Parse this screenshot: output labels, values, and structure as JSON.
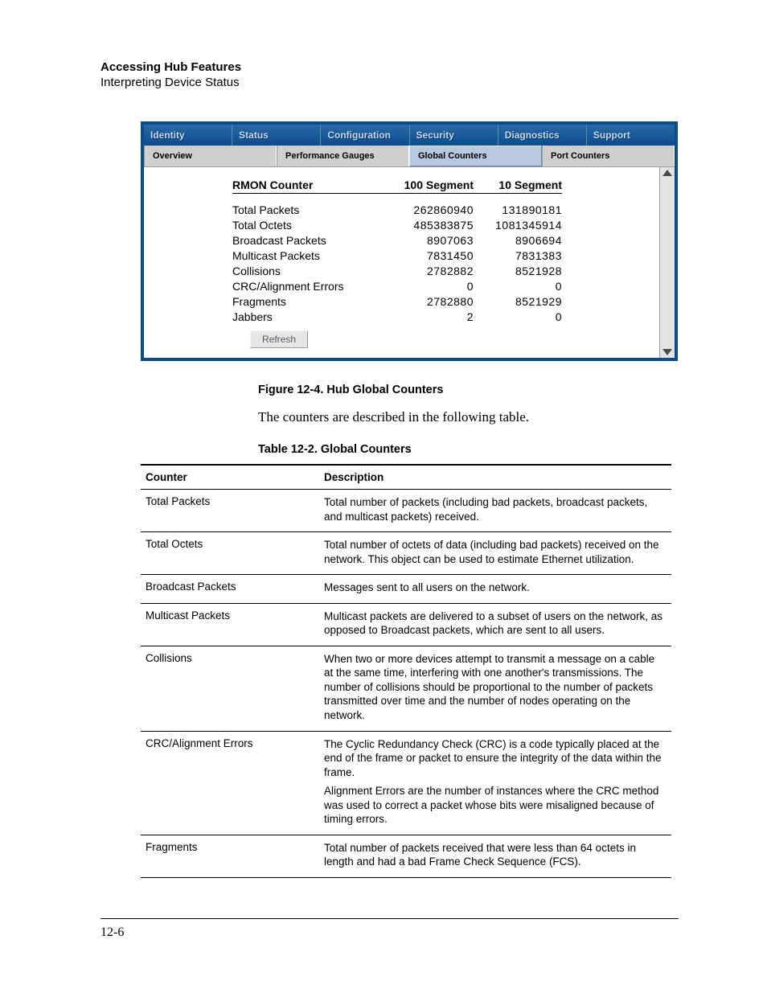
{
  "header": {
    "title": "Accessing Hub Features",
    "subtitle": "Interpreting Device Status"
  },
  "app": {
    "topTabs": [
      "Identity",
      "Status",
      "Configuration",
      "Security",
      "Diagnostics",
      "Support"
    ],
    "subTabs": [
      "Overview",
      "Performance Gauges",
      "Global Counters",
      "Port Counters"
    ],
    "subTabActiveIndex": 2,
    "dataHeader": {
      "name": "RMON Counter",
      "colA": "100 Segment",
      "colB": "10 Segment"
    },
    "rows": [
      {
        "name": "Total Packets",
        "a": "262860940",
        "b": "131890181"
      },
      {
        "name": "Total Octets",
        "a": "485383875",
        "b": "1081345914"
      },
      {
        "name": "Broadcast Packets",
        "a": "8907063",
        "b": "8906694"
      },
      {
        "name": "Multicast Packets",
        "a": "7831450",
        "b": "7831383"
      },
      {
        "name": "Collisions",
        "a": "2782882",
        "b": "8521928"
      },
      {
        "name": "CRC/Alignment Errors",
        "a": "0",
        "b": "0"
      },
      {
        "name": "Fragments",
        "a": "2782880",
        "b": "8521929"
      },
      {
        "name": "Jabbers",
        "a": "2",
        "b": "0"
      }
    ],
    "refreshLabel": "Refresh"
  },
  "figureCaption": "Figure 12-4. Hub Global Counters",
  "bodyParagraph": "The counters are described in the following table.",
  "tableCaption": "Table 12-2.   Global Counters",
  "descTable": {
    "headers": {
      "counter": "Counter",
      "description": "Description"
    },
    "rows": [
      {
        "counter": "Total Packets",
        "desc": [
          "Total number of packets (including bad packets, broadcast packets, and multicast packets) received."
        ]
      },
      {
        "counter": "Total Octets",
        "desc": [
          "Total number of octets of data (including bad packets) received on the network. This object can be used to estimate Ethernet utilization."
        ]
      },
      {
        "counter": "Broadcast Packets",
        "desc": [
          "Messages sent to all users on the network."
        ]
      },
      {
        "counter": "Multicast Packets",
        "desc": [
          "Multicast packets are delivered to a subset of users on the network, as opposed to Broadcast packets, which are sent to all users."
        ]
      },
      {
        "counter": "Collisions",
        "desc": [
          "When two or more devices attempt to transmit a message on a cable at the same time, interfering with one another's transmissions. The number of collisions should be proportional to the number of packets transmitted over time and the number of nodes operating on the network."
        ]
      },
      {
        "counter": "CRC/Alignment Errors",
        "desc": [
          "The Cyclic Redundancy Check (CRC) is a code typically placed at the end of the frame or packet to ensure the integrity of the data within the frame.",
          "Alignment Errors are the number of instances where the CRC method was used to correct a packet whose bits were misaligned because of timing errors."
        ]
      },
      {
        "counter": "Fragments",
        "desc": [
          "Total number of packets received that were less than 64 octets in length and had a bad Frame Check Sequence (FCS)."
        ]
      }
    ]
  },
  "pageNumber": "12-6",
  "chart_data": {
    "type": "table",
    "title": "RMON Counter — Global Counters",
    "columns": [
      "RMON Counter",
      "100 Segment",
      "10 Segment"
    ],
    "rows": [
      [
        "Total Packets",
        262860940,
        131890181
      ],
      [
        "Total Octets",
        485383875,
        1081345914
      ],
      [
        "Broadcast Packets",
        8907063,
        8906694
      ],
      [
        "Multicast Packets",
        7831450,
        7831383
      ],
      [
        "Collisions",
        2782882,
        8521928
      ],
      [
        "CRC/Alignment Errors",
        0,
        0
      ],
      [
        "Fragments",
        2782880,
        8521929
      ],
      [
        "Jabbers",
        2,
        0
      ]
    ]
  }
}
